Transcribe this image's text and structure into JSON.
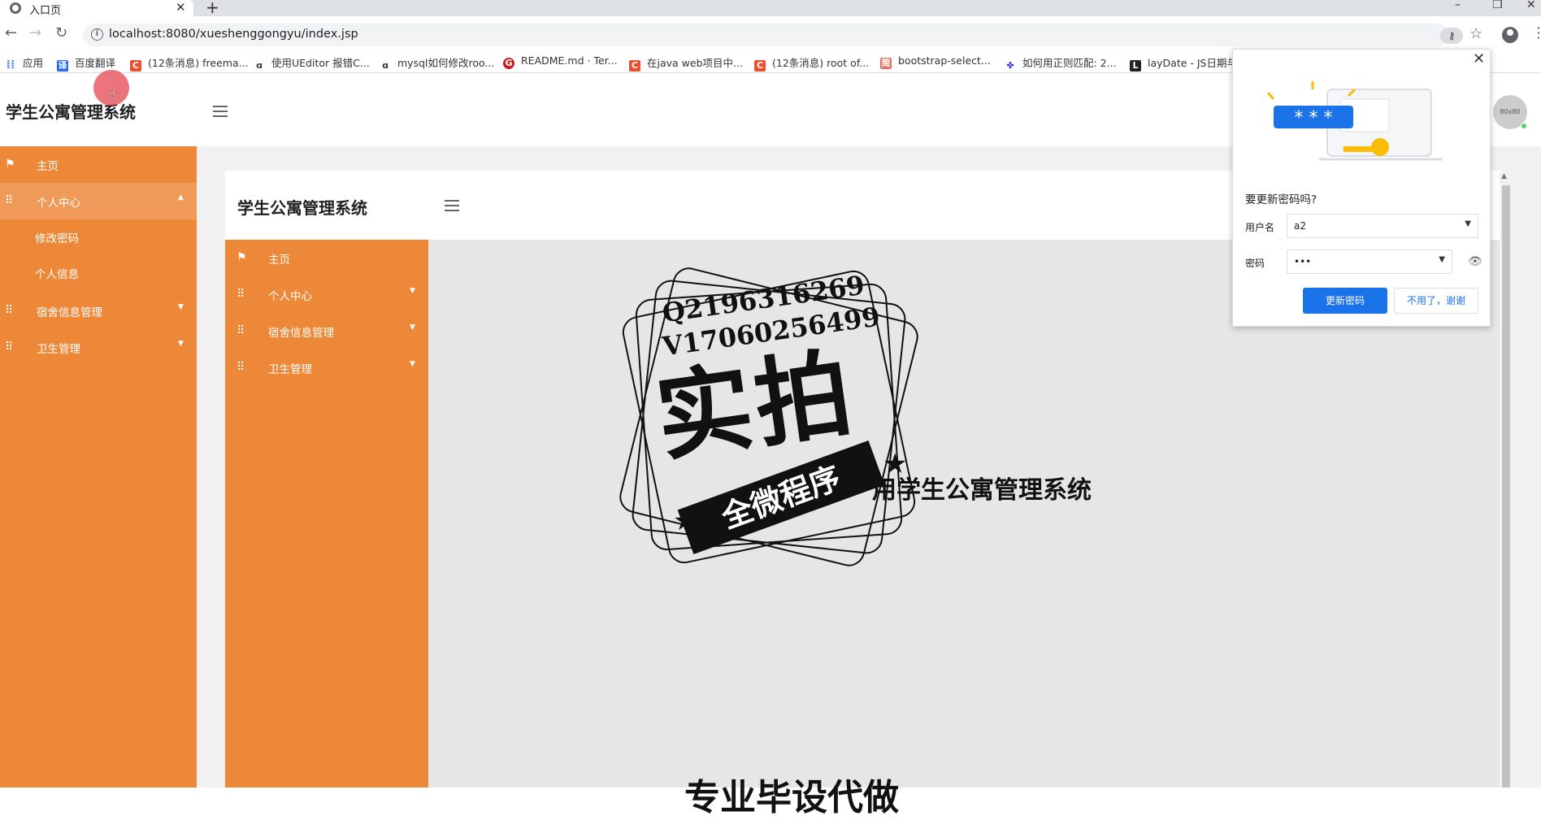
{
  "browser": {
    "tab_title": "入口页",
    "tab_close": "✕",
    "new_tab": "+",
    "url": "localhost:8080/xueshenggongyu/index.jsp",
    "nav_back": "←",
    "nav_forward": "→",
    "nav_reload": "↻",
    "star": "☆",
    "menu": "⋮",
    "key": "⚷",
    "window_controls": {
      "minimize": "–",
      "restore": "❐",
      "close": "✕"
    }
  },
  "bookmarks": [
    {
      "label": "应用",
      "icon": "apps-grid-icon",
      "color": "#4285f4"
    },
    {
      "label": "百度翻译",
      "icon": "baidu-translate-icon",
      "color": "#2468f2"
    },
    {
      "label": "(12条消息) freema...",
      "icon": "csdn-icon",
      "color": "#e8502e"
    },
    {
      "label": "使用UEditor 报错C...",
      "icon": "jianshu-icon",
      "color": "#333333"
    },
    {
      "label": "mysql如何修改roo...",
      "icon": "jianshu-icon",
      "color": "#333333"
    },
    {
      "label": "README.md · Ter...",
      "icon": "gitee-icon",
      "color": "#c71d23"
    },
    {
      "label": "在java web项目中...",
      "icon": "csdn-icon",
      "color": "#e8502e"
    },
    {
      "label": "(12条消息) root of...",
      "icon": "csdn-icon",
      "color": "#e8502e"
    },
    {
      "label": "bootstrap-select...",
      "icon": "jianshu-red-icon",
      "color": "#ea6f5a"
    },
    {
      "label": "如何用正则匹配: 2...",
      "icon": "baidu-paw-icon",
      "color": "#2932e1"
    },
    {
      "label": "layDate - JS日期与",
      "icon": "laydate-icon",
      "color": "#222222"
    }
  ],
  "app": {
    "title": "学生公寓管理系统",
    "avatar_text": "80x80",
    "sidebar": {
      "items": [
        {
          "label": "主页",
          "icon": "flag-icon"
        },
        {
          "label": "个人中心",
          "icon": "grid-icon",
          "caret": "▲"
        },
        {
          "label": "宿舍信息管理",
          "icon": "grid-icon",
          "caret": "▼"
        },
        {
          "label": "卫生管理",
          "icon": "grid-icon",
          "caret": "▼"
        }
      ],
      "subitems": [
        {
          "label": "修改密码"
        },
        {
          "label": "个人信息"
        }
      ]
    }
  },
  "inner": {
    "title": "学生公寓管理系统",
    "sidebar": {
      "items": [
        {
          "label": "主页",
          "icon": "flag-icon"
        },
        {
          "label": "个人中心",
          "icon": "grid-icon",
          "caret": "▼"
        },
        {
          "label": "宿舍信息管理",
          "icon": "grid-icon",
          "caret": "▼"
        },
        {
          "label": "卫生管理",
          "icon": "grid-icon",
          "caret": "▼"
        }
      ]
    },
    "welcome": "用学生公寓管理系统",
    "bottom_text": "专业毕设代做"
  },
  "watermark": {
    "line1": "Q2196316269",
    "line2": "V17060256499",
    "big": "实拍",
    "ribbon": "全微程序"
  },
  "password_popup": {
    "question": "要更新密码吗?",
    "username_label": "用户名",
    "username_value": "a2",
    "password_label": "密码",
    "password_value": "•••",
    "update_button": "更新密码",
    "no_thanks_button": "不用了，谢谢",
    "close": "✕",
    "masked_display": "* * *"
  },
  "colors": {
    "sidebar": "#ed8838",
    "primary_button": "#1a73e8"
  }
}
